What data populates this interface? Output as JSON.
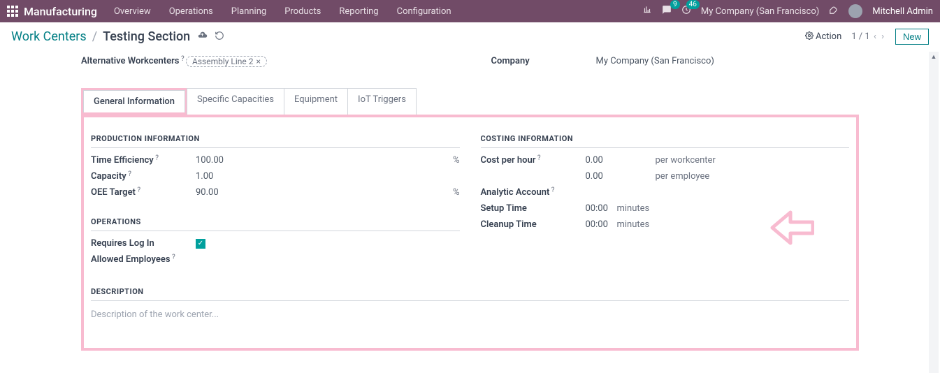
{
  "topnav": {
    "brand": "Manufacturing",
    "menu": [
      "Overview",
      "Operations",
      "Planning",
      "Products",
      "Reporting",
      "Configuration"
    ],
    "messaging_count": "9",
    "activity_count": "46",
    "company": "My Company (San Francisco)",
    "user": "Mitchell Admin"
  },
  "breadcrumb": {
    "root": "Work Centers",
    "current": "Testing Section"
  },
  "controls": {
    "action_label": "Action",
    "pager": "1 / 1",
    "new_label": "New"
  },
  "header_fields": {
    "alt_workcenters_label": "Alternative Workcenters",
    "alt_workcenters_tag": "Assembly Line 2",
    "company_label": "Company",
    "company_value": "My Company (San Francisco)"
  },
  "tabs": [
    "General Information",
    "Specific Capacities",
    "Equipment",
    "IoT Triggers"
  ],
  "sections": {
    "production_title": "PRODUCTION INFORMATION",
    "time_eff_label": "Time Efficiency",
    "time_eff_value": "100.00",
    "capacity_label": "Capacity",
    "capacity_value": "1.00",
    "oee_label": "OEE Target",
    "oee_value": "90.00",
    "operations_title": "OPERATIONS",
    "requires_login_label": "Requires Log In",
    "requires_login_checked": true,
    "allowed_emp_label": "Allowed Employees",
    "description_title": "DESCRIPTION",
    "description_placeholder": "Description of the work center...",
    "costing_title": "COSTING INFORMATION",
    "cost_hour_label": "Cost per hour",
    "cost_hour_wc": "0.00",
    "cost_hour_wc_unit": "per workcenter",
    "cost_hour_emp": "0.00",
    "cost_hour_emp_unit": "per employee",
    "analytic_label": "Analytic Account",
    "setup_label": "Setup Time",
    "setup_value": "00:00",
    "setup_unit": "minutes",
    "cleanup_label": "Cleanup Time",
    "cleanup_value": "00:00",
    "cleanup_unit": "minutes",
    "pct": "%"
  }
}
